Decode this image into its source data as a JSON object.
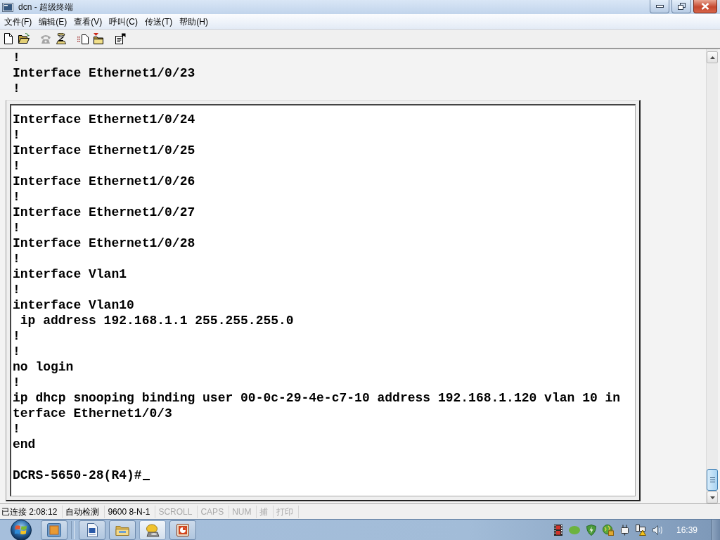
{
  "window": {
    "title": "dcn - 超级终端"
  },
  "menu": [
    "文件(F)",
    "编辑(E)",
    "查看(V)",
    "呼叫(C)",
    "传送(T)",
    "帮助(H)"
  ],
  "toolbar": [
    {
      "kind": "new",
      "disabled": false
    },
    {
      "kind": "open",
      "disabled": false
    },
    {
      "kind": "call",
      "disabled": true
    },
    {
      "kind": "hangup",
      "disabled": false
    },
    {
      "kind": "send",
      "disabled": false
    },
    {
      "kind": "receive",
      "disabled": false
    },
    {
      "kind": "properties",
      "disabled": false
    }
  ],
  "terminal": {
    "lines_above": [
      "!",
      "Interface Ethernet1/0/23",
      "!"
    ],
    "panel_lines": [
      "Interface Ethernet1/0/24",
      "!",
      "Interface Ethernet1/0/25",
      "!",
      "Interface Ethernet1/0/26",
      "!",
      "Interface Ethernet1/0/27",
      "!",
      "Interface Ethernet1/0/28",
      "!",
      "interface Vlan1",
      "!",
      "interface Vlan10",
      " ip address 192.168.1.1 255.255.255.0",
      "!",
      "!",
      "no login",
      "!",
      "ip dhcp snooping binding user 00-0c-29-4e-c7-10 address 192.168.1.120 vlan 10 in",
      "terface Ethernet1/0/3",
      "!",
      "end"
    ],
    "prompt": "DCRS-5650-28(R4)#"
  },
  "status_bar": {
    "fields": [
      {
        "text": "已连接 2:08:12",
        "active": true
      },
      {
        "text": "自动检测",
        "active": true
      },
      {
        "text": "9600 8-N-1",
        "active": true
      },
      {
        "text": "SCROLL",
        "active": false
      },
      {
        "text": "CAPS",
        "active": false
      },
      {
        "text": "NUM",
        "active": false
      },
      {
        "text": "捕",
        "active": false
      },
      {
        "text": "打印",
        "active": false
      }
    ]
  },
  "taskbar": {
    "buttons": [
      {
        "kind": "app",
        "selected": false
      },
      {
        "kind": "word",
        "selected": false
      },
      {
        "kind": "explorer",
        "selected": false
      },
      {
        "kind": "terminal",
        "selected": true
      },
      {
        "kind": "presentation",
        "selected": false
      }
    ],
    "clock": "16:39"
  }
}
